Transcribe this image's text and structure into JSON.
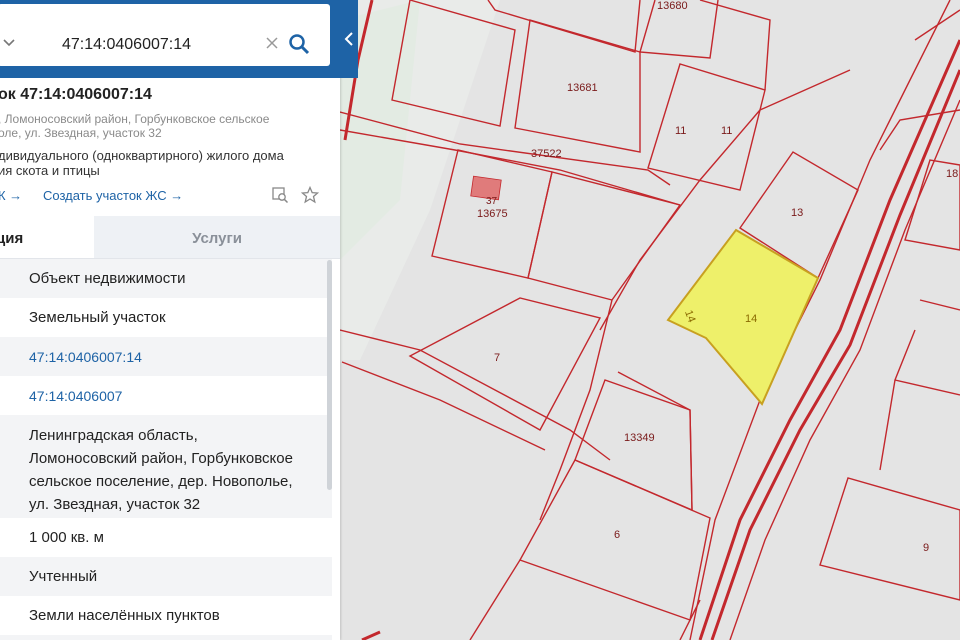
{
  "search": {
    "value": "47:14:0406007:14"
  },
  "card": {
    "title": "ок 47:14:0406007:14",
    "address_line1": ", Ломоносовский район, Горбунковское сельское",
    "address_line2": "оле, ул. Звездная, участок 32",
    "usage_line1": "дивидуального (одноквартирного) жилого дома",
    "usage_line2": "ия скота и птицы",
    "link_k": "К →",
    "link_create": "Создать участок ЖС →"
  },
  "tabs": {
    "info": "ция",
    "services": "Услуги"
  },
  "rows": [
    "Объект недвижимости",
    "Земельный участок",
    "47:14:0406007:14",
    "47:14:0406007",
    "Ленинградская область,\nЛомоносовский район, Горбунковское\nсельское поселение, дер. Новополье,\nул. Звездная, участок 32",
    "1 000 кв. м",
    "Учтенный",
    "Земли населённых пунктов"
  ],
  "map": {
    "labels": {
      "p13680": "13680",
      "p13681": "13681",
      "p37522": "37522",
      "p11a": "11",
      "p11b": "11",
      "p13675": "13675",
      "p37": "37",
      "p13": "13",
      "p14": "14",
      "p14b": "14",
      "p7": "7",
      "p13349": "13349",
      "p6": "6",
      "p9": "9",
      "p18": "18"
    },
    "colors": {
      "boundary": "#c3282d",
      "selected_fill": "#eef06a",
      "building": "#e07b7b"
    }
  }
}
